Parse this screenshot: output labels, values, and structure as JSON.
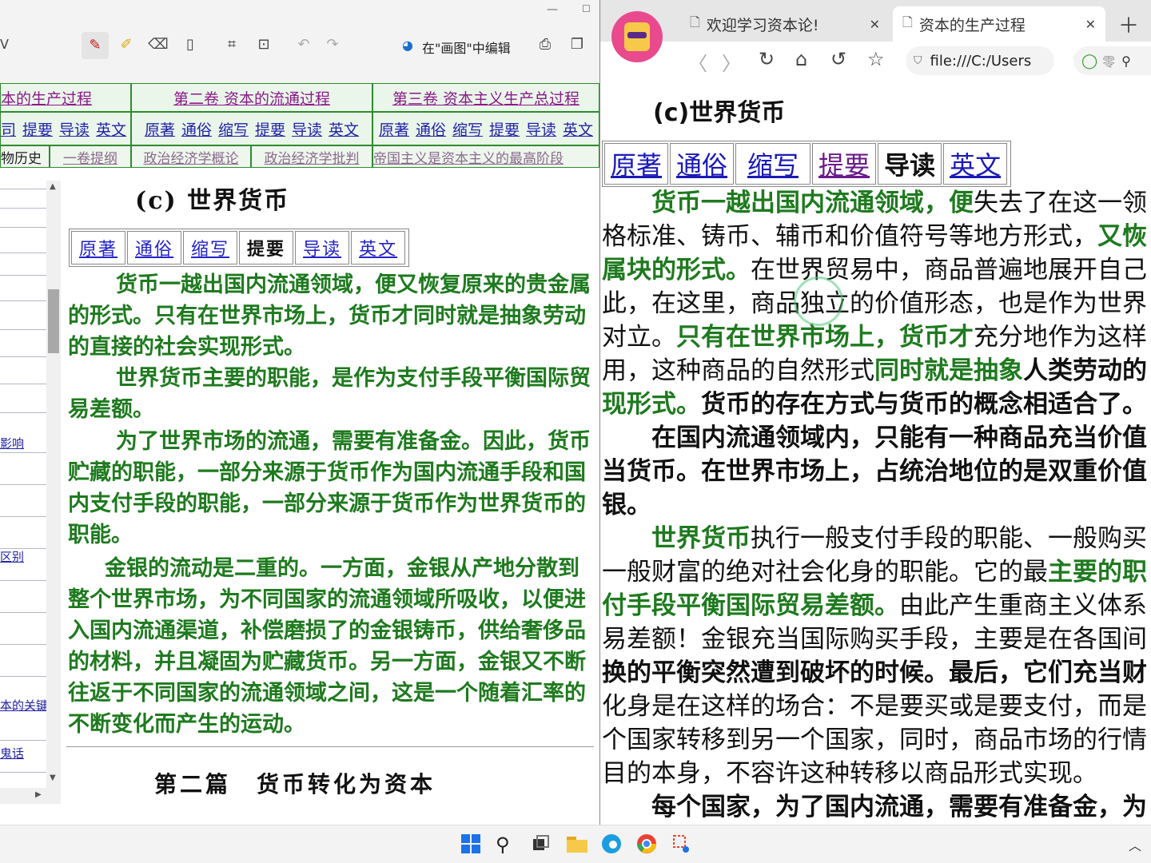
{
  "left": {
    "toolbar": {
      "edit_in_paint": "在\"画图\"中编辑"
    },
    "nav": {
      "volumes": [
        "本的生产过程",
        "第二卷 资本的流通过程",
        "第三卷 资本主义生产总过程"
      ],
      "row2_cell1": [
        "司",
        "提要",
        "导读",
        "英文"
      ],
      "row2_cell2": [
        "原著",
        "通俗",
        "缩写",
        "提要",
        "导读",
        "英文"
      ],
      "row2_cell3": [
        "原著",
        "通俗",
        "缩写",
        "提要",
        "导读",
        "英文"
      ],
      "row3": [
        "物历史",
        "一卷提纲",
        "政治经济学概论",
        "政治经济学批判",
        "帝国主义是资本主义的最高阶段"
      ]
    },
    "sidebar": {
      "links": [
        "影响",
        "区别",
        "本的关键",
        "鬼话"
      ]
    },
    "content": {
      "title": "(c) 世界货币",
      "tabs": [
        "原著",
        "通俗",
        "缩写",
        "提要",
        "导读",
        "英文"
      ],
      "paragraphs": [
        "货币一越出国内流通领域，便又恢复原来的贵金属的形式。只有在世界市场上，货币才同时就是抽象劳动的直接的社会实现形式。",
        "世界货币主要的职能，是作为支付手段平衡国际贸易差额。",
        "为了世界市场的流通，需要有准备金。因此，货币贮藏的职能，一部分来源于货币作为国内流通手段和国内支付手段的职能，一部分来源于货币作为世界货币的职能。",
        "金银的流动是二重的。一方面，金银从产地分散到整个世界市场，为不同国家的流通领域所吸收，以便进入国内流通渠道，补偿磨损了的金银铸币，供给奢侈品的材料，并且凝固为贮藏货币。另一方面，金银又不断往返于不同国家的流通领域之间，这是一个随着汇率的不断变化而产生的运动。"
      ],
      "part_title": "第二篇　货币转化为资本"
    }
  },
  "right": {
    "tabs": [
      "欢迎学习资本论!",
      "资本的生产过程"
    ],
    "url": "file:///C:/Users",
    "search_placeholder": "零",
    "content": {
      "title": "(c)世界货币",
      "tabs": [
        "原著",
        "通俗",
        "缩写",
        "提要",
        "导读",
        "英文"
      ],
      "lines": [
        [
          "",
          "货币一越出国内流通领域，便",
          "失去了在这一领"
        ],
        [
          "格标准、铸币、辅币和价值符号等地方形式，",
          "又恢",
          ""
        ],
        [
          "",
          "属块的形式。",
          "在世界贸易中，商品普遍地展开自己"
        ],
        [
          "此，在这里，商品独立的价值形态，也是作为世界",
          "",
          ""
        ],
        [
          "对立。",
          "只有在世界市场上，货币才",
          "充分地作为这样"
        ],
        [
          "用，这种商品的自然形式",
          "同时就是抽象",
          "人类劳动的"
        ],
        [
          "",
          "现形式。",
          "货币的存在方式与货币的概念相适合了。"
        ],
        [
          "",
          "",
          "在国内流通领域内，只能有一种商品充当价值"
        ],
        [
          "当货币。在世界市场上，占统治地位的是双重价值",
          "",
          ""
        ],
        [
          "银。",
          "",
          ""
        ],
        [
          "",
          "世界货币",
          "执行一般支付手段的职能、一般购买"
        ],
        [
          "一般财富的绝对社会化身的职能。它的最",
          "主要的职",
          ""
        ],
        [
          "",
          "付手段平衡国际贸易差额。",
          "由此产生重商主义体系"
        ],
        [
          "易差额！金银充当国际购买手段，主要是在各国间",
          "",
          ""
        ],
        [
          "换的平衡突然遭到破坏的时候。最后，它们充当财",
          "",
          ""
        ],
        [
          "化身是在这样的场合：不是要买或是要支付，而是",
          "",
          ""
        ],
        [
          "个国家转移到另一个国家，同时，商品市场的行情",
          "",
          ""
        ],
        [
          "目的本身，不容许这种转移以商品形式实现。",
          "",
          ""
        ],
        [
          "",
          "",
          "每个国家，为了国内流通，需要有准备金，为"
        ]
      ]
    }
  }
}
